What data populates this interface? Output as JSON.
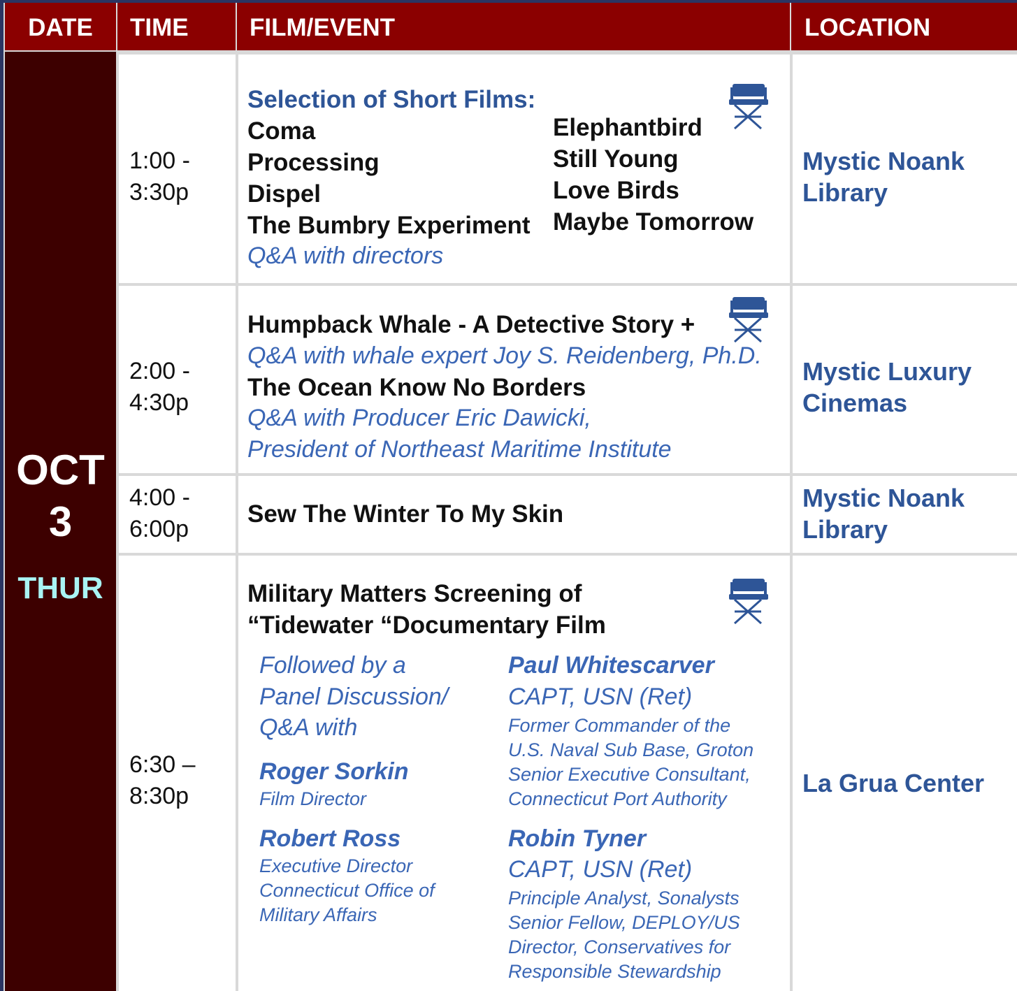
{
  "header": {
    "date": "DATE",
    "time": "TIME",
    "film": "FILM/EVENT",
    "location": "LOCATION"
  },
  "date": {
    "month_day_1": "OCT",
    "month_day_2": "3",
    "weekday": "THUR"
  },
  "rows": [
    {
      "time_1": "1:00 -",
      "time_2": "3:30p",
      "heading": "Selection of Short Films:",
      "films_left": [
        "Coma",
        "Processing",
        "Dispel",
        "The Bumbry Experiment"
      ],
      "films_right": [
        "Elephantbird",
        "Still Young",
        "Love Birds",
        "Maybe Tomorrow"
      ],
      "qa": "Q&A with directors",
      "location_1": "Mystic Noank",
      "location_2": "Library"
    },
    {
      "time_1": "2:00 -",
      "time_2": "4:30p",
      "film_1": "Humpback Whale - A Detective Story  +",
      "qa_1": "Q&A with whale expert Joy S. Reidenberg, Ph.D.",
      "film_2": "The Ocean Know No Borders",
      "qa_2": "Q&A with Producer Eric Dawicki,",
      "qa_3": "President of Northeast Maritime Institute",
      "location_1": "Mystic Luxury",
      "location_2": "Cinemas"
    },
    {
      "time_1": "4:00 -",
      "time_2": "6:00p",
      "film": "Sew The Winter To My Skin",
      "location_1": "Mystic Noank",
      "location_2": "Library"
    },
    {
      "time_1": "6:30 –",
      "time_2": "8:30p",
      "film_1": "Military Matters Screening of",
      "film_2": "“Tidewater “Documentary Film",
      "intro": [
        "Followed by a",
        "Panel Discussion/",
        "Q&A with"
      ],
      "panel_left": [
        {
          "name": "Roger Sorkin",
          "lines": [
            "Film Director"
          ]
        },
        {
          "name": "Robert Ross",
          "lines": [
            "Executive Director",
            "Connecticut Office of",
            "Military Affairs"
          ]
        }
      ],
      "panel_right": [
        {
          "name": "Paul Whitescarver",
          "rank": "CAPT, USN (Ret)",
          "lines": [
            "Former Commander of the",
            "U.S. Naval Sub Base, Groton",
            "Senior Executive Consultant,",
            "Connecticut Port Authority"
          ]
        },
        {
          "name": "Robin Tyner",
          "rank": "CAPT, USN (Ret)",
          "lines": [
            "Principle Analyst, Sonalysts",
            "Senior Fellow, DEPLOY/US",
            "Director, Conservatives for",
            "Responsible Stewardship"
          ]
        }
      ],
      "location": "La Grua Center"
    }
  ],
  "icons": {
    "chair": "director-chair-icon",
    "color": "#2e5597"
  },
  "colors": {
    "header_bg": "#8b0000",
    "date_bg": "#3d0000",
    "accent_blue": "#2e5597",
    "weekday": "#a9f4f4"
  }
}
